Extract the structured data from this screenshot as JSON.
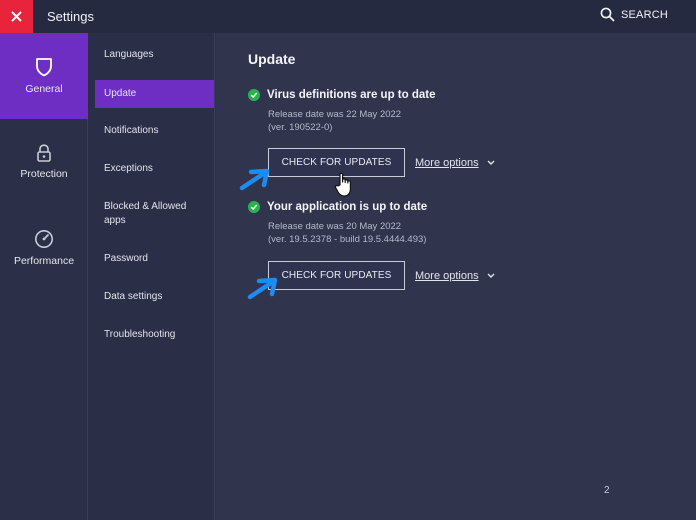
{
  "app": {
    "title": "Settings",
    "search_label": "SEARCH"
  },
  "rail": {
    "items": [
      {
        "label": "General",
        "icon": "shield-icon"
      },
      {
        "label": "Protection",
        "icon": "lock-icon"
      },
      {
        "label": "Performance",
        "icon": "speedometer-icon"
      }
    ]
  },
  "submenu": {
    "items": [
      {
        "label": "Languages"
      },
      {
        "label": "Update"
      },
      {
        "label": "Notifications"
      },
      {
        "label": "Exceptions"
      },
      {
        "label": "Blocked & Allowed apps"
      },
      {
        "label": "Password"
      },
      {
        "label": "Data settings"
      },
      {
        "label": "Troubleshooting"
      }
    ]
  },
  "main": {
    "heading": "Update",
    "virus": {
      "status": "Virus definitions are up to date",
      "release": "Release date was 22 May 2022",
      "version": "(ver. 190522-0)",
      "button": "CHECK FOR UPDATES",
      "more": "More options"
    },
    "app": {
      "status": "Your application is up to date",
      "release": "Release date was 20 May 2022",
      "version": "(ver. 19.5.2378 - build 19.5.4444.493)",
      "button": "CHECK FOR UPDATES",
      "more": "More options"
    },
    "page_number": "2"
  },
  "colors": {
    "accent": "#6f2ec3",
    "close": "#e8243c",
    "ok": "#27b24a",
    "annotation": "#1e8bf0"
  }
}
